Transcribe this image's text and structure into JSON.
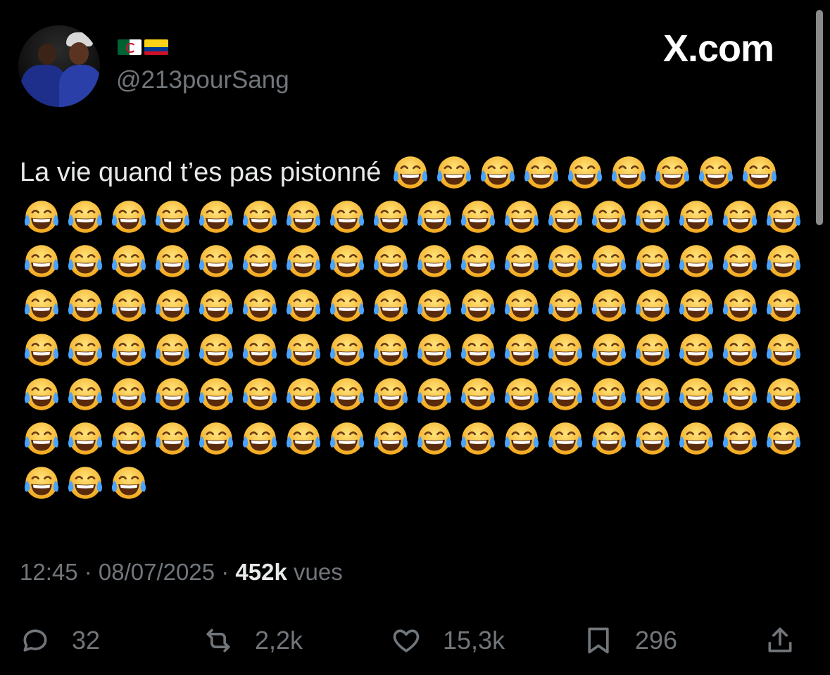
{
  "profile": {
    "flags": [
      "algeria-flag",
      "colombia-flag"
    ],
    "handle": "@213pourSang"
  },
  "brand": {
    "logo_text": "X.com"
  },
  "tweet": {
    "text": "La vie quand t’es pas pistonné",
    "emoji": "face-with-tears-of-joy",
    "emoji_count": 120
  },
  "meta": {
    "time": "12:45",
    "sep1": " · ",
    "date": "08/07/2025",
    "sep2": " · ",
    "views_count": "452k",
    "views_label": " vues"
  },
  "actions": {
    "replies": "32",
    "reposts": "2,2k",
    "likes": "15,3k",
    "bookmarks": "296"
  },
  "icons": {
    "reply": "reply-icon",
    "repost": "repost-icon",
    "like": "heart-icon",
    "bookmark": "bookmark-icon",
    "share": "share-icon"
  }
}
